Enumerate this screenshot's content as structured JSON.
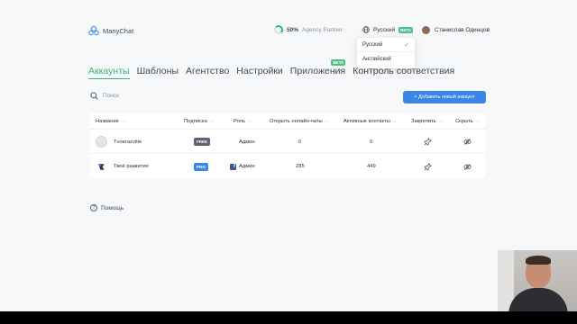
{
  "header": {
    "brand": "ManyChat",
    "agency_percent": "50%",
    "agency_label": "Agency Partner",
    "language": "Русский",
    "beta_badge": "BETA",
    "user_name": "Станислав Одинцов"
  },
  "language_dropdown": {
    "options": [
      "Русский",
      "Английский"
    ],
    "selected": "Русский"
  },
  "tabs": [
    {
      "label": "Аккаунты",
      "active": true
    },
    {
      "label": "Шаблоны"
    },
    {
      "label": "Агентство"
    },
    {
      "label": "Настройки"
    },
    {
      "label": "Приложения",
      "badge": "BETA"
    },
    {
      "label": "Контроль соответствия"
    }
  ],
  "search": {
    "placeholder": "Поиск"
  },
  "add_button": "+ Добавить новый аккаунт",
  "table": {
    "columns": [
      "Название",
      "Подписка",
      "Роль",
      "Открыть онлайн-чаты",
      "Активные контакты",
      "Закрепить",
      "Скрыть"
    ],
    "rows": [
      {
        "name": "Tvoerazvitie",
        "plan": "FREE",
        "role": "Админ",
        "open_chats": "0",
        "active_contacts": "0"
      },
      {
        "name": "Твоё развитие",
        "plan": "PRO",
        "role": "Админ",
        "open_chats": "285",
        "active_contacts": "449"
      }
    ]
  },
  "help": "Помощь",
  "colors": {
    "accent_green": "#2fb870",
    "button_blue": "#3b85e8",
    "free_badge": "#5b6470"
  },
  "icons": [
    "manychat-logo-icon",
    "progress-ring-icon",
    "globe-icon",
    "search-icon",
    "pin-icon",
    "eye-off-icon",
    "facebook-icon",
    "help-icon",
    "check-icon"
  ]
}
